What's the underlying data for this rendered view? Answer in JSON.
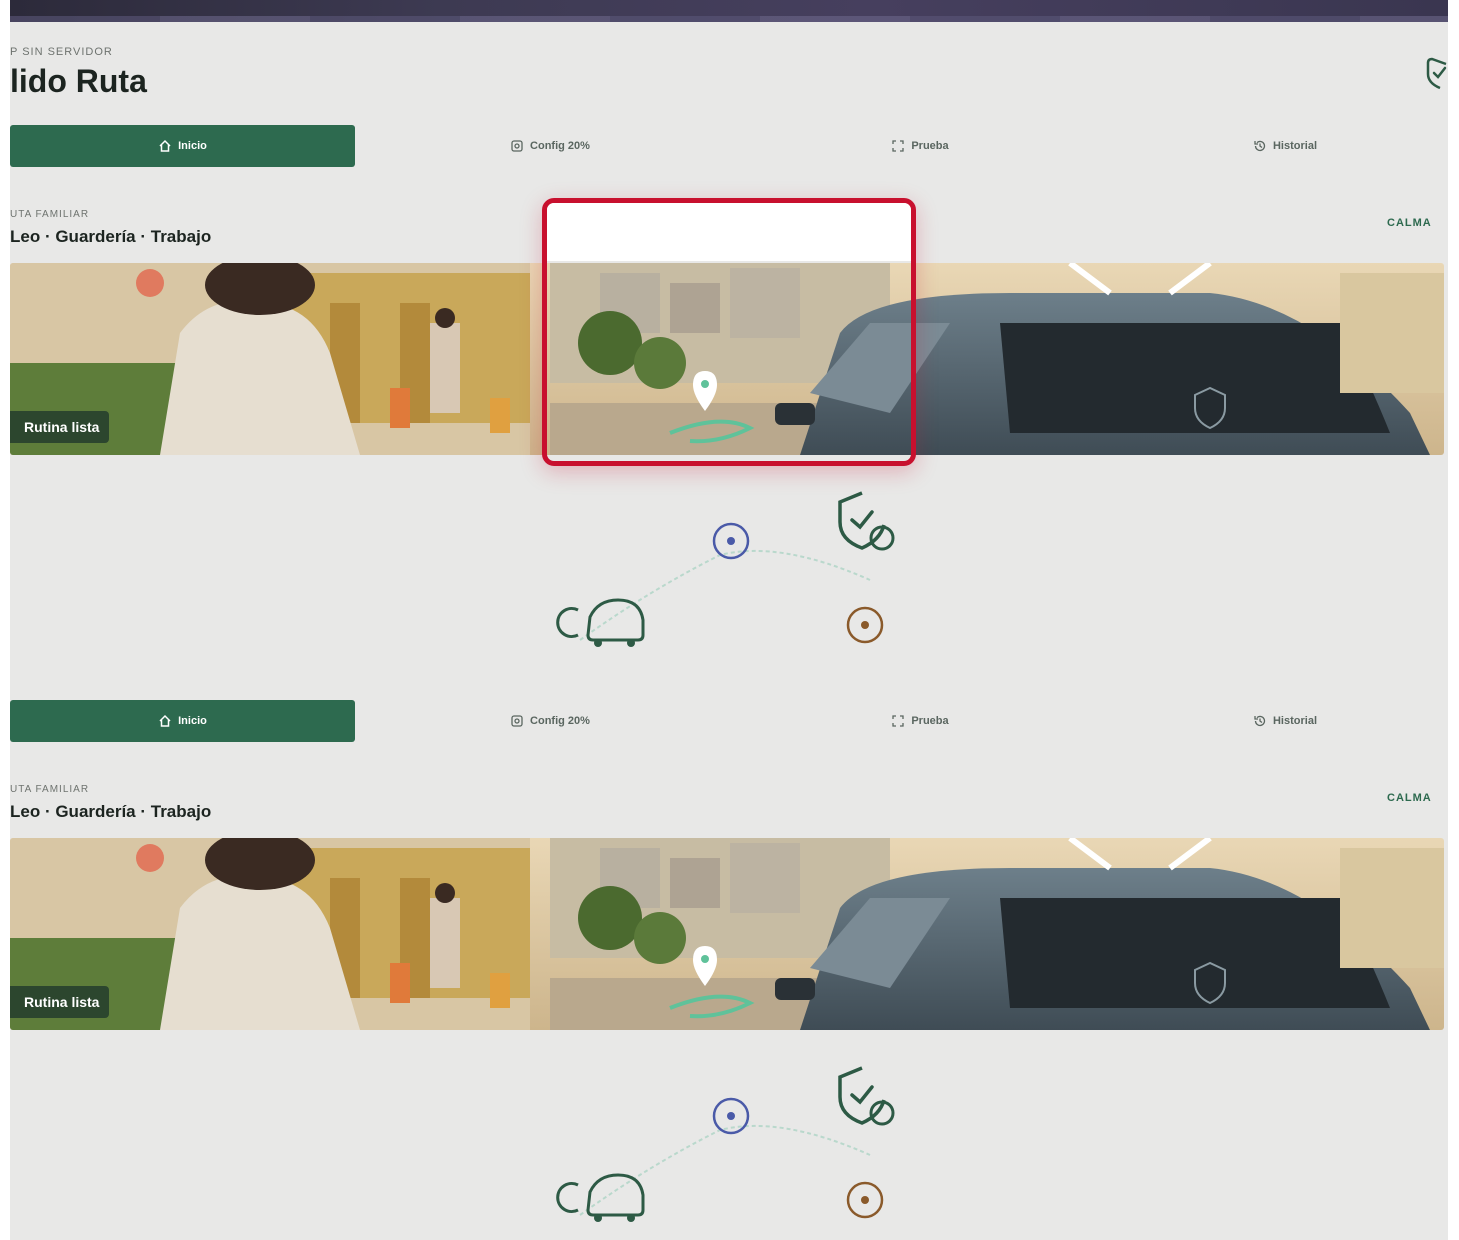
{
  "header": {
    "eyebrow": "P SIN SERVIDOR",
    "title": "lido Ruta"
  },
  "nav": {
    "tabs": [
      {
        "label": "Inicio",
        "icon": "home-icon",
        "active": true
      },
      {
        "label": "Config 20%",
        "icon": "settings-icon",
        "active": false
      },
      {
        "label": "Prueba",
        "icon": "scan-icon",
        "active": false
      },
      {
        "label": "Historial",
        "icon": "history-icon",
        "active": false
      }
    ]
  },
  "route": {
    "eyebrow": "UTA FAMILIAR",
    "title": "Leo · Guardería · Trabajo",
    "status": "CALMA",
    "badge": "Rutina lista"
  },
  "colors": {
    "accent": "#2d6a4f",
    "highlight": "#c8102e",
    "background": "#e8e8e7",
    "pin_blue": "#4a5aa8",
    "pin_brown": "#8a5a2b"
  }
}
